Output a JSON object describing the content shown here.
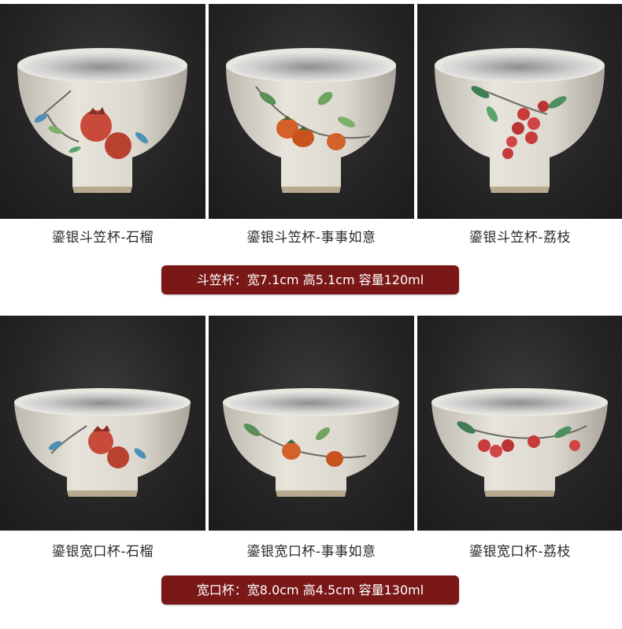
{
  "rows": [
    {
      "products": [
        {
          "caption": "鎏银斗笠杯-石榴",
          "motif": "pomegranate"
        },
        {
          "caption": "鎏银斗笠杯-事事如意",
          "motif": "persimmon"
        },
        {
          "caption": "鎏银斗笠杯-荔枝",
          "motif": "lychee"
        }
      ],
      "spec": "斗笠杯：宽7.1cm 高5.1cm 容量120ml"
    },
    {
      "products": [
        {
          "caption": "鎏银宽口杯-石榴",
          "motif": "pomegranate"
        },
        {
          "caption": "鎏银宽口杯-事事如意",
          "motif": "persimmon"
        },
        {
          "caption": "鎏银宽口杯-荔枝",
          "motif": "lychee"
        }
      ],
      "spec": "宽口杯：宽8.0cm 高4.5cm 容量130ml"
    }
  ],
  "colors": {
    "background": "#ffffff",
    "photo_backdrop": "#262626",
    "spec_banner": "#7a1818",
    "cup_glaze": "#dedbd2",
    "silver_lining": "#c9c9c7"
  }
}
